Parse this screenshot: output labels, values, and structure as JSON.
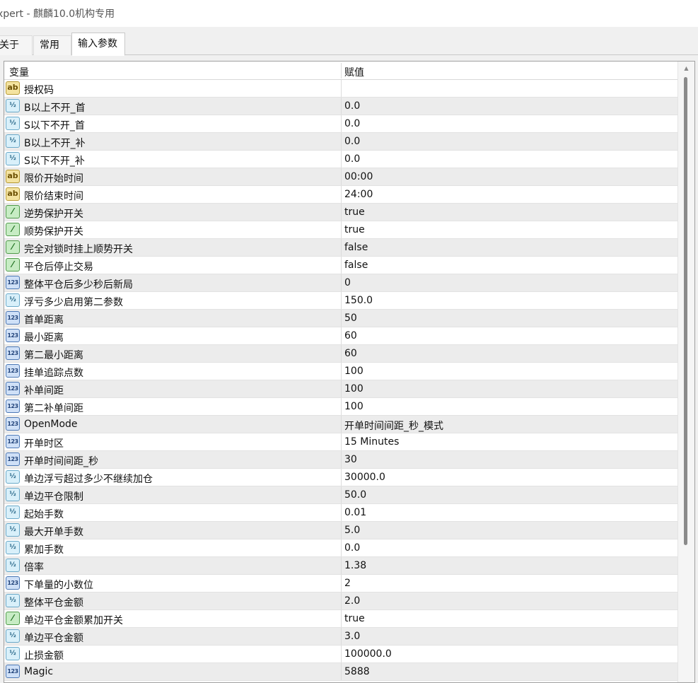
{
  "window": {
    "title": "xpert - 麒麟10.0机构专用"
  },
  "tabs": [
    {
      "label": "关于",
      "active": false
    },
    {
      "label": "常用",
      "active": false
    },
    {
      "label": "输入参数",
      "active": true
    }
  ],
  "table": {
    "headers": {
      "variable": "变量",
      "value": "赋值"
    },
    "icon_styles": {
      "string": {
        "glyph": "ab",
        "icon": "string-type-icon"
      },
      "double": {
        "glyph": "½",
        "icon": "double-type-icon"
      },
      "bool": {
        "glyph": "⁄",
        "icon": "bool-type-icon"
      },
      "int": {
        "glyph": "123",
        "icon": "int-type-icon"
      }
    },
    "rows": [
      {
        "type": "string",
        "name": "授权码",
        "value": ""
      },
      {
        "type": "double",
        "name": "B以上不开_首",
        "value": "0.0"
      },
      {
        "type": "double",
        "name": "S以下不开_首",
        "value": "0.0"
      },
      {
        "type": "double",
        "name": "B以上不开_补",
        "value": "0.0"
      },
      {
        "type": "double",
        "name": "S以下不开_补",
        "value": "0.0"
      },
      {
        "type": "string",
        "name": "限价开始时间",
        "value": "00:00"
      },
      {
        "type": "string",
        "name": "限价结束时间",
        "value": "24:00"
      },
      {
        "type": "bool",
        "name": "逆势保护开关",
        "value": "true"
      },
      {
        "type": "bool",
        "name": "顺势保护开关",
        "value": "true"
      },
      {
        "type": "bool",
        "name": "完全对锁时挂上顺势开关",
        "value": "false"
      },
      {
        "type": "bool",
        "name": "平仓后停止交易",
        "value": "false"
      },
      {
        "type": "int",
        "name": "整体平仓后多少秒后新局",
        "value": "0"
      },
      {
        "type": "double",
        "name": "浮亏多少启用第二参数",
        "value": "150.0"
      },
      {
        "type": "int",
        "name": "首单距离",
        "value": "50"
      },
      {
        "type": "int",
        "name": "最小距离",
        "value": "60"
      },
      {
        "type": "int",
        "name": "第二最小距离",
        "value": "60"
      },
      {
        "type": "int",
        "name": "挂单追踪点数",
        "value": "100"
      },
      {
        "type": "int",
        "name": "补单间距",
        "value": "100"
      },
      {
        "type": "int",
        "name": "第二补单间距",
        "value": "100"
      },
      {
        "type": "int",
        "name": "OpenMode",
        "value": "开单时间间距_秒_模式"
      },
      {
        "type": "int",
        "name": "开单时区",
        "value": "15 Minutes"
      },
      {
        "type": "int",
        "name": "开单时间间距_秒",
        "value": "30"
      },
      {
        "type": "double",
        "name": "单边浮亏超过多少不继续加仓",
        "value": "30000.0"
      },
      {
        "type": "double",
        "name": "单边平仓限制",
        "value": "50.0"
      },
      {
        "type": "double",
        "name": "起始手数",
        "value": "0.01"
      },
      {
        "type": "double",
        "name": "最大开单手数",
        "value": "5.0"
      },
      {
        "type": "double",
        "name": "累加手数",
        "value": "0.0"
      },
      {
        "type": "double",
        "name": "倍率",
        "value": "1.38"
      },
      {
        "type": "int",
        "name": "下单量的小数位",
        "value": "2"
      },
      {
        "type": "double",
        "name": "整体平仓金额",
        "value": "2.0"
      },
      {
        "type": "bool",
        "name": "单边平仓金额累加开关",
        "value": "true"
      },
      {
        "type": "double",
        "name": "单边平仓金额",
        "value": "3.0"
      },
      {
        "type": "double",
        "name": "止损金额",
        "value": "100000.0"
      },
      {
        "type": "int",
        "name": "Magic",
        "value": "5888"
      }
    ]
  }
}
